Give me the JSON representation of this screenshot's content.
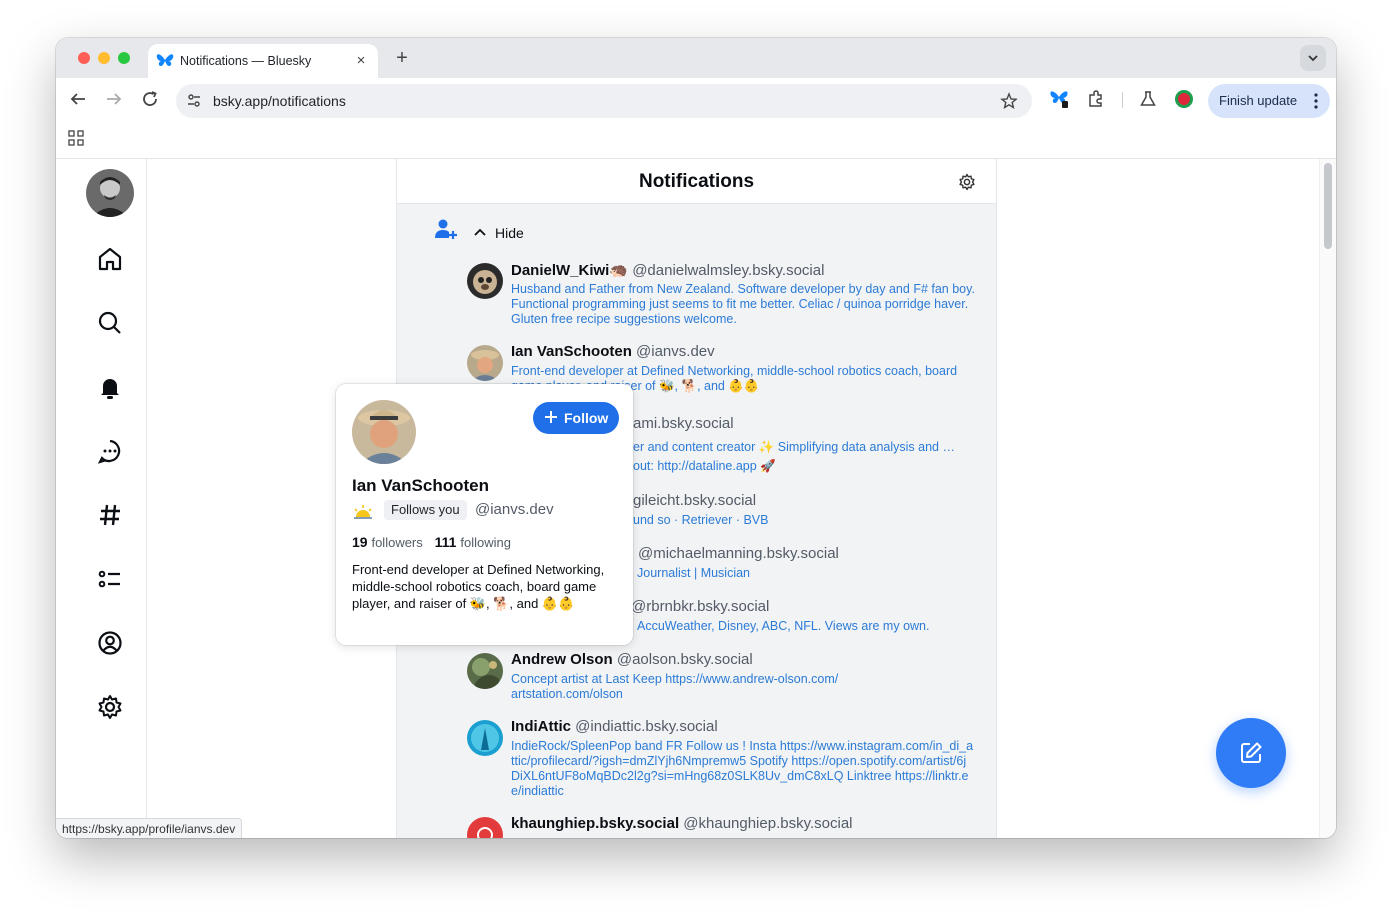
{
  "browser": {
    "tab_title": "Notifications — Bluesky",
    "url": "bsky.app/notifications",
    "finish_update_label": "Finish update",
    "status_url": "https://bsky.app/profile/ianvs.dev",
    "close_glyph": "×",
    "newtab_glyph": "+"
  },
  "page": {
    "title": "Notifications",
    "hide_label": "Hide"
  },
  "users": [
    {
      "name": "DanielW_Kiwi🦔",
      "handle": "@danielwalmsley.bsky.social",
      "bio": "Husband and Father from New Zealand. Software developer by day and F# fan boy. Functional programming just seems to fit me better. Celiac / quinoa porridge haver. Gluten free recipe suggestions welcome."
    },
    {
      "name": "Ian VanSchooten",
      "handle": "@ianvs.dev",
      "bio": "Front-end developer at Defined Networking, middle-school robotics coach, board game player, and raiser of 🐝, 🐕, and 👶👶"
    },
    {
      "name": "",
      "handle": "ami.bsky.social",
      "bio": "er and content creator ✨ Simplifying data analysis and … out: http://dataline.app 🚀"
    },
    {
      "name": "",
      "handle": "gileicht.bsky.social",
      "bio": "und so · Retriever · BVB"
    },
    {
      "name": "",
      "handle": "@michaelmanning.bsky.social",
      "bio": "Journalist | Musician"
    },
    {
      "name": "",
      "handle": "@rbrnbkr.bsky.social",
      "bio": "AccuWeather, Disney, ABC, NFL. Views are my own."
    },
    {
      "name": "Andrew Olson",
      "handle": "@aolson.bsky.social",
      "bio": "Concept artist at Last Keep https://www.andrew-olson.com/ artstation.com/olson"
    },
    {
      "name": "IndiAttic",
      "handle": "@indiattic.bsky.social",
      "bio": "IndieRock/SpleenPop band FR Follow us ! Insta https://www.instagram.com/in_di_attic/profilecard/?igsh=dmZlYjh6Nmpremw5 Spotify https://open.spotify.com/artist/6jDiXL6ntUF8oMqBDc2l2g?si=mHng68z0SLK8Uv_dmC8xLQ Linktree https://linktr.ee/indiattic"
    },
    {
      "name": "khaunghiep.bsky.social",
      "handle": "@khaunghiep.bsky.social",
      "bio": ""
    }
  ],
  "hovercard": {
    "name": "Ian VanSchooten",
    "follows_you": "Follows you",
    "handle": "@ianvs.dev",
    "followers_count": "19",
    "followers_label": "followers",
    "following_count": "111",
    "following_label": "following",
    "bio": "Front-end developer at Defined Networking, middle-school robotics coach, board game player, and raiser of 🐝, 🐕, and 👶👶",
    "follow_label": "Follow"
  },
  "colors": {
    "accent": "#1f6fe8",
    "link": "#2c7bd6",
    "fab": "#2f7cf6",
    "notif_bg": "#f1f3f5"
  },
  "icons": [
    "bluesky-butterfly-icon",
    "back-icon",
    "forward-icon",
    "reload-icon",
    "tune-icon",
    "star-icon",
    "extensions-icon",
    "labs-icon",
    "profile-icon",
    "apps-icon",
    "home-icon",
    "search-icon",
    "bell-icon",
    "chat-icon",
    "hashtag-icon",
    "lists-icon",
    "profile-circle-icon",
    "gear-icon",
    "person-add-icon",
    "chevron-up-icon",
    "compose-icon"
  ]
}
